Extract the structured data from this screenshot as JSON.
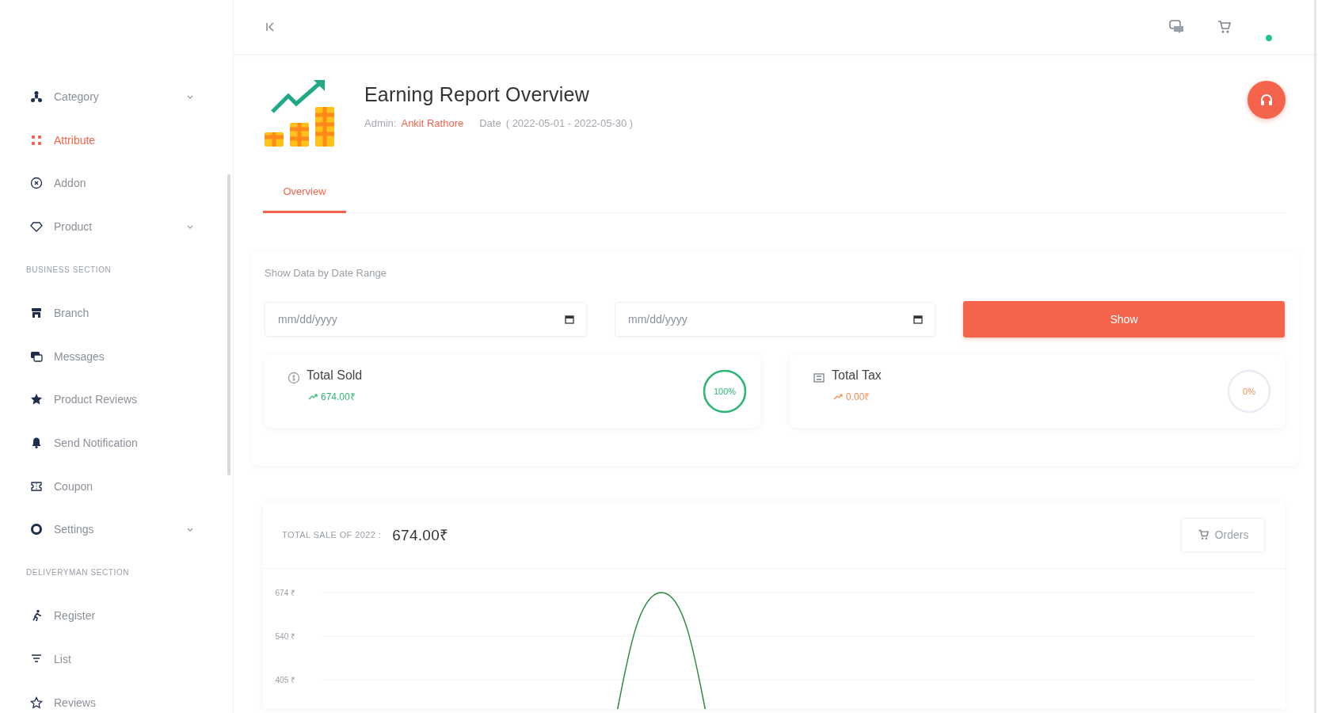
{
  "sidebar": {
    "items": [
      {
        "kind": "link",
        "label": "Category",
        "selected": false,
        "expandable": true
      },
      {
        "kind": "link",
        "label": "Attribute",
        "selected": true,
        "expandable": false
      },
      {
        "kind": "link",
        "label": "Addon",
        "selected": false,
        "expandable": false
      },
      {
        "kind": "link",
        "label": "Product",
        "selected": false,
        "expandable": true
      },
      {
        "kind": "header",
        "label": "BUSINESS SECTION"
      },
      {
        "kind": "link",
        "label": "Branch",
        "selected": false,
        "expandable": false
      },
      {
        "kind": "link",
        "label": "Messages",
        "selected": false,
        "expandable": false
      },
      {
        "kind": "link",
        "label": "Product Reviews",
        "selected": false,
        "expandable": false
      },
      {
        "kind": "link",
        "label": "Send Notification",
        "selected": false,
        "expandable": false
      },
      {
        "kind": "link",
        "label": "Coupon",
        "selected": false,
        "expandable": false
      },
      {
        "kind": "link",
        "label": "Settings",
        "selected": false,
        "expandable": true
      },
      {
        "kind": "header",
        "label": "DELIVERYMAN SECTION"
      },
      {
        "kind": "link",
        "label": "Register",
        "selected": false,
        "expandable": false
      },
      {
        "kind": "link",
        "label": "List",
        "selected": false,
        "expandable": false
      },
      {
        "kind": "link",
        "label": "Reviews",
        "selected": false,
        "expandable": false
      }
    ]
  },
  "header": {
    "title": "Earning Report Overview",
    "admin_label": "Admin:",
    "admin_name": "Ankit Rathore",
    "date_label": "Date",
    "date_range": "( 2022-05-01 - 2022-05-30 )"
  },
  "tabs": [
    {
      "label": "Overview",
      "selected": true
    }
  ],
  "filter": {
    "label": "Show Data by Date Range",
    "date_fields": [
      {
        "placeholder": "mm/dd/yyyy"
      },
      {
        "placeholder": "mm/dd/yyyy"
      }
    ],
    "button": "Show"
  },
  "stats": [
    {
      "label": "Total Sold",
      "value": "674.00₹",
      "percent": "100%",
      "color": "#2bb673"
    },
    {
      "label": "Total Tax",
      "value": "0.00₹",
      "percent": "0%",
      "color": "#f28b50"
    }
  ],
  "sales": {
    "label": "TOTAL SALE OF 2022 :",
    "total": "674.00₹",
    "orders_button": "Orders",
    "axis_labels": [
      "674 ₹",
      "540 ₹",
      "405 ₹"
    ]
  }
}
